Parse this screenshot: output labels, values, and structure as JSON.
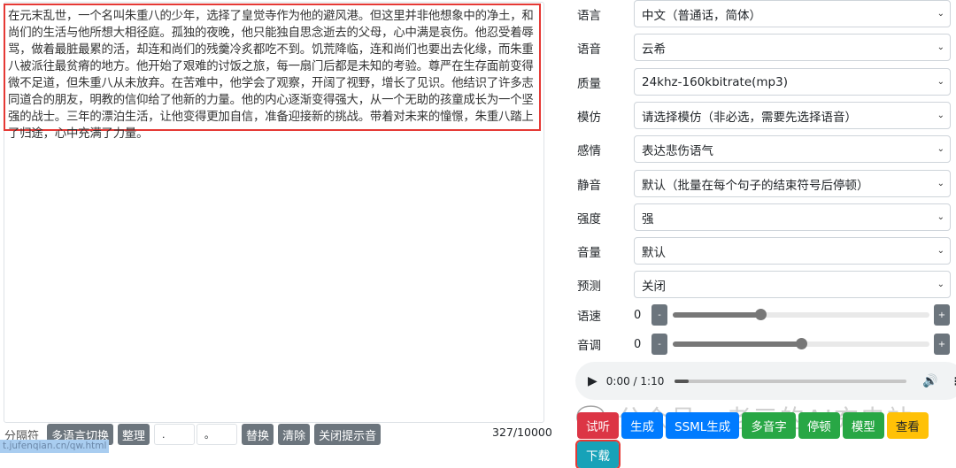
{
  "editor": {
    "text": "在元末乱世，一个名叫朱重八的少年，选择了皇觉寺作为他的避风港。但这里并非他想象中的净土，和尚们的生活与他所想大相径庭。孤独的夜晚，他只能独自思念逝去的父母，心中满是哀伤。他忍受着辱骂，做着最脏最累的活，却连和尚们的残羹冷炙都吃不到。饥荒降临，连和尚们也要出去化缘，而朱重八被派往最贫瘠的地方。他开始了艰难的讨饭之旅，每一扇门后都是未知的考验。尊严在生存面前变得微不足道，但朱重八从未放弃。在苦难中，他学会了观察，开阔了视野，增长了见识。他结识了许多志同道合的朋友，明教的信仰给了他新的力量。他的内心逐渐变得强大，从一个无助的孩童成长为一个坚强的战士。三年的漂泊生活，让他变得更加自信，准备迎接新的挑战。带着对未来的憧憬，朱重八踏上了归途，心中充满了力量。",
    "count": "327/10000"
  },
  "toolbar": {
    "separator_label": "分隔符",
    "multilang": "多语言切换",
    "tidy": "整理",
    "find_value": ".",
    "replace_value": "。",
    "replace": "替换",
    "clear": "清除",
    "close_tip": "关闭提示音"
  },
  "status_url": "t.jufenqian.cn/qw.html",
  "settings": [
    {
      "label": "语言",
      "value": "中文（普通话，简体）"
    },
    {
      "label": "语音",
      "value": "云希"
    },
    {
      "label": "质量",
      "value": "24khz-160kbitrate(mp3)"
    },
    {
      "label": "模仿",
      "value": "请选择模仿（非必选，需要先选择语音）"
    },
    {
      "label": "感情",
      "value": "表达悲伤语气"
    },
    {
      "label": "静音",
      "value": "默认（批量在每个句子的结束符号后停顿）"
    },
    {
      "label": "强度",
      "value": "强"
    },
    {
      "label": "音量",
      "value": "默认"
    },
    {
      "label": "预测",
      "value": "关闭"
    }
  ],
  "sliders": [
    {
      "label": "语速",
      "value": "0",
      "minus": "-",
      "plus": "+",
      "level": 0.34
    },
    {
      "label": "音调",
      "value": "0",
      "minus": "-",
      "plus": "+",
      "level": 0.5
    }
  ],
  "audio": {
    "time": "0:00 / 1:10",
    "progress": 0.06
  },
  "actions": [
    {
      "label": "试听",
      "color": "#dc3545"
    },
    {
      "label": "生成",
      "color": "#007bff"
    },
    {
      "label": "SSML生成",
      "color": "#007bff"
    },
    {
      "label": "多音字",
      "color": "#28a745"
    },
    {
      "label": "停顿",
      "color": "#28a745"
    },
    {
      "label": "模型",
      "color": "#28a745"
    },
    {
      "label": "查看",
      "color": "#ffc107"
    },
    {
      "label": "下载",
      "color": "#17a2b8"
    }
  ],
  "watermark": "公众号 · 老三的AI充电站"
}
